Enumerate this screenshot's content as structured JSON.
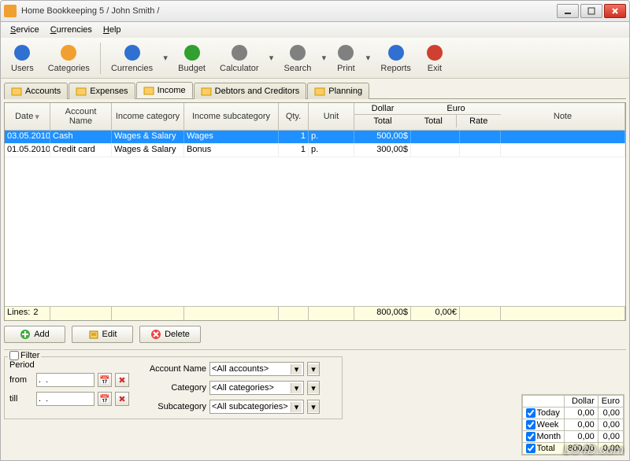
{
  "window": {
    "title": "Home Bookkeeping 5  / John Smith /"
  },
  "menubar": [
    "Service",
    "Currencies",
    "Help"
  ],
  "toolbar": [
    {
      "label": "Users",
      "drop": false,
      "icon": "people"
    },
    {
      "label": "Categories",
      "drop": false,
      "icon": "category"
    },
    {
      "sep": true
    },
    {
      "label": "Currencies",
      "drop": true,
      "icon": "dollar"
    },
    {
      "label": "Budget",
      "drop": false,
      "icon": "pie"
    },
    {
      "label": "Calculator",
      "drop": true,
      "icon": "calc"
    },
    {
      "label": "Search",
      "drop": true,
      "icon": "search"
    },
    {
      "label": "Print",
      "drop": true,
      "icon": "print"
    },
    {
      "label": "Reports",
      "drop": false,
      "icon": "chart"
    },
    {
      "label": "Exit",
      "drop": false,
      "icon": "exit"
    }
  ],
  "tabs": [
    {
      "label": "Accounts",
      "active": false
    },
    {
      "label": "Expenses",
      "active": false
    },
    {
      "label": "Income",
      "active": true
    },
    {
      "label": "Debtors and Creditors",
      "active": false
    },
    {
      "label": "Planning",
      "active": false
    }
  ],
  "grid": {
    "headers": {
      "date": "Date",
      "account": "Account Name",
      "category": "Income category",
      "subcategory": "Income subcategory",
      "qty": "Qty.",
      "unit": "Unit",
      "dollar": "Dollar",
      "euro": "Euro",
      "total": "Total",
      "rate": "Rate",
      "note": "Note"
    },
    "rows": [
      {
        "date": "03.05.2010",
        "account": "Cash",
        "category": "Wages & Salary",
        "subcategory": "Wages",
        "qty": "1",
        "unit": "p.",
        "dollar_total": "500,00$",
        "euro_total": "",
        "rate": "",
        "note": "",
        "selected": true
      },
      {
        "date": "01.05.2010",
        "account": "Credit card",
        "category": "Wages & Salary",
        "subcategory": "Bonus",
        "qty": "1",
        "unit": "p.",
        "dollar_total": "300,00$",
        "euro_total": "",
        "rate": "",
        "note": "",
        "selected": false
      }
    ],
    "footer": {
      "lines_label": "Lines:",
      "lines": "2",
      "dollar_total": "800,00$",
      "euro_total": "0,00€"
    }
  },
  "actions": {
    "add": "Add",
    "edit": "Edit",
    "delete": "Delete"
  },
  "filter": {
    "label": "Filter",
    "period_label": "Period",
    "from_label": "from",
    "till_label": "till",
    "date_placeholder": ".  .",
    "account_label": "Account Name",
    "account_value": "<All accounts>",
    "category_label": "Category",
    "category_value": "<All categories>",
    "subcat_label": "Subcategory",
    "subcat_value": "<All subcategories>"
  },
  "summary": {
    "headers": {
      "dollar": "Dollar",
      "euro": "Euro"
    },
    "rows": [
      {
        "label": "Today",
        "dollar": "0,00",
        "euro": "0,00"
      },
      {
        "label": "Week",
        "dollar": "0,00",
        "euro": "0,00"
      },
      {
        "label": "Month",
        "dollar": "0,00",
        "euro": "0,00"
      },
      {
        "label": "Total",
        "dollar": "800,00",
        "euro": "0,00",
        "total": true
      }
    ]
  },
  "watermark": "LO4D.com",
  "icons": {
    "people": "#3070d0",
    "category": "#f0a030",
    "dollar": "#3070d0",
    "pie": "#30a030",
    "calc": "#808080",
    "search": "#808080",
    "print": "#808080",
    "chart": "#3070d0",
    "exit": "#d04030"
  }
}
